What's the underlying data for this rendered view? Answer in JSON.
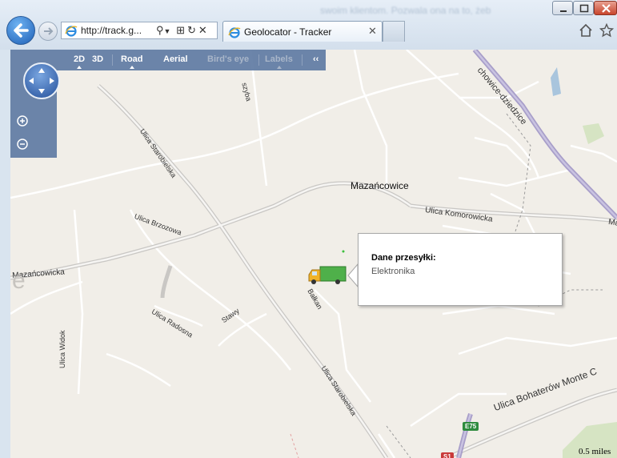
{
  "browser": {
    "address_url": "http://track.g...",
    "tab_title": "Geolocator - Tracker",
    "background_text": "swoim klientom. Pozwala ona na to, żeb"
  },
  "map_controls": {
    "view_2d": "2D",
    "view_3d": "3D",
    "road": "Road",
    "aerial": "Aerial",
    "birds_eye": "Bird's eye",
    "labels": "Labels",
    "collapse": "‹‹"
  },
  "map_labels": {
    "place_main": "Mazańcowice",
    "street_mazancowicka": "Mazańcowicka",
    "street_starobielska_1": "Ulica Starobielska",
    "street_starobielska_2": "Ulica Starobielska",
    "street_brzozowa": "Ulica Brzozowa",
    "street_radosna": "Ulica Radosna",
    "street_stawy": "Stawy",
    "street_balkan": "Bałkan",
    "street_widok": "Ulica Widok",
    "street_komorowicka": "Ulica Komorowicka",
    "street_bohaterow": "Ulica Bohaterów Monte C",
    "railway": "chowice-dziedzice",
    "road_ma": "Ma",
    "road_szyba": "szyba",
    "shield_e75": "E75",
    "shield_s1": "S1",
    "big_letter": "e"
  },
  "infobox": {
    "title": "Dane przesyłki:",
    "value": "Elektronika"
  },
  "scale": {
    "label": "0.5 miles"
  }
}
